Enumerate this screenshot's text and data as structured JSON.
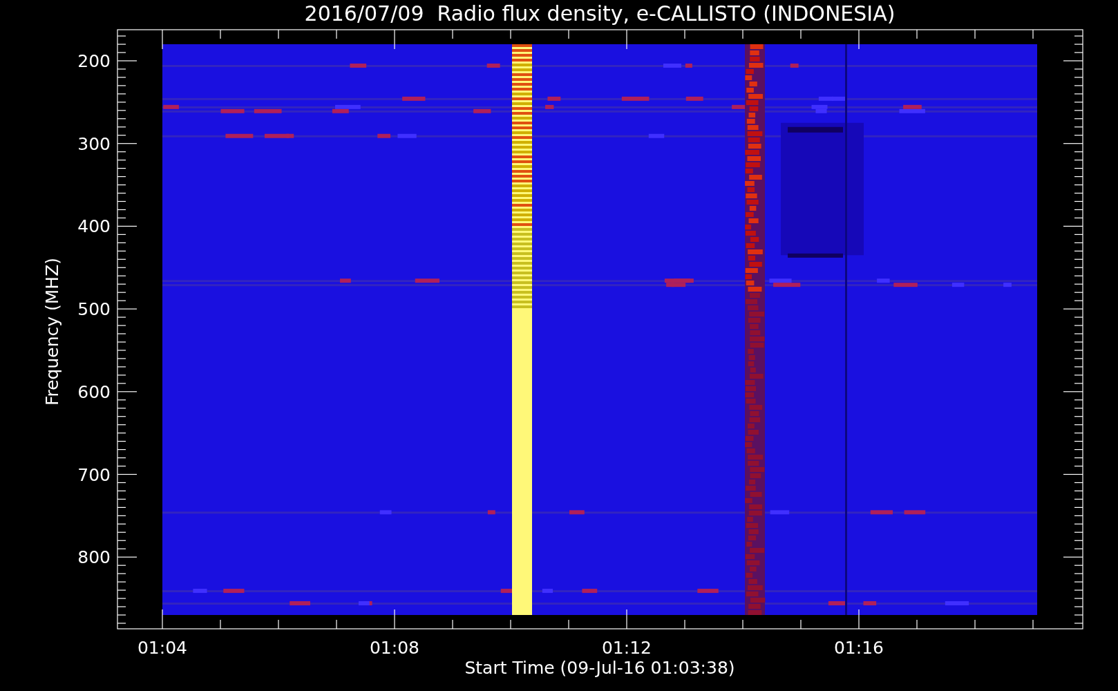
{
  "title": "2016/07/09  Radio flux density, e-CALLISTO (INDONESIA)",
  "ylabel": "Frequency (MHZ)",
  "xlabel": "Start Time (09-Jul-16 01:03:38)",
  "y_tick_labels": [
    "200",
    "300",
    "400",
    "500",
    "600",
    "700",
    "800"
  ],
  "x_tick_labels": [
    "01:04",
    "01:08",
    "01:12",
    "01:16"
  ]
}
